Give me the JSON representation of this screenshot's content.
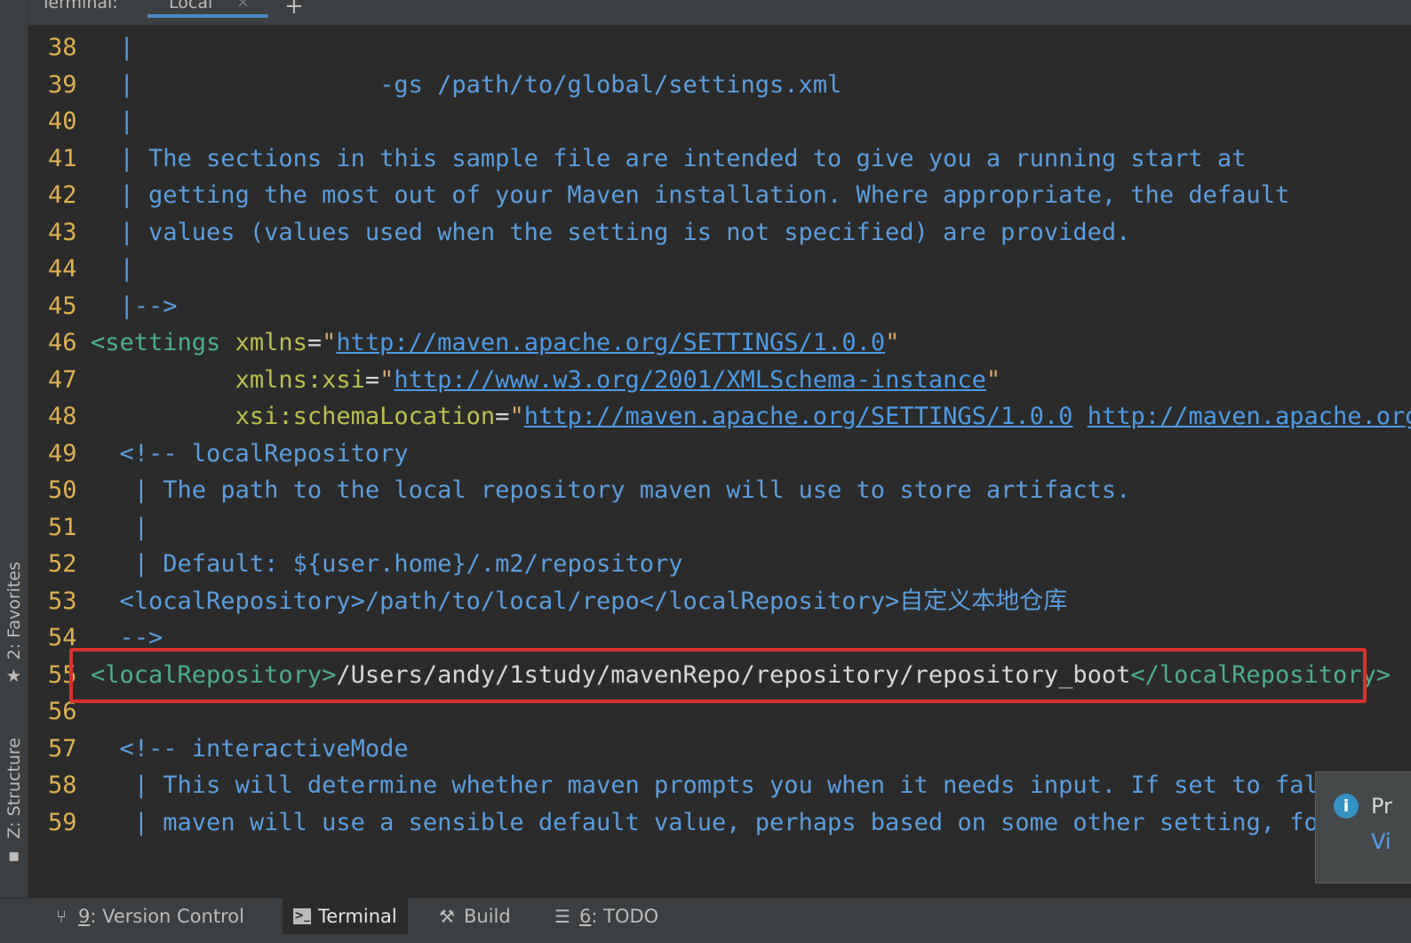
{
  "tabbar": {
    "title": "Terminal:",
    "active_tab": "Local",
    "close_glyph": "×",
    "add_glyph": "+"
  },
  "left_stripe": {
    "favorites": "2: Favorites",
    "favorites_icon": "star-icon",
    "structure": "Z: Structure",
    "structure_icon": "structure-icon"
  },
  "editor": {
    "lines": [
      {
        "n": "38",
        "parts": [
          {
            "c": "comment",
            "t": "|"
          }
        ],
        "indent": "  "
      },
      {
        "n": "39",
        "parts": [
          {
            "c": "comment",
            "t": "|                 -gs /path/to/global/settings.xml"
          }
        ],
        "indent": "  "
      },
      {
        "n": "40",
        "parts": [
          {
            "c": "comment",
            "t": "|"
          }
        ],
        "indent": "  "
      },
      {
        "n": "41",
        "parts": [
          {
            "c": "comment",
            "t": "| The sections in this sample file are intended to give you a running start at"
          }
        ],
        "indent": "  "
      },
      {
        "n": "42",
        "parts": [
          {
            "c": "comment",
            "t": "| getting the most out of your Maven installation. Where appropriate, the default"
          }
        ],
        "indent": "  "
      },
      {
        "n": "43",
        "parts": [
          {
            "c": "comment",
            "t": "| values (values used when the setting is not specified) are provided."
          }
        ],
        "indent": "  "
      },
      {
        "n": "44",
        "parts": [
          {
            "c": "comment",
            "t": "|"
          }
        ],
        "indent": "  "
      },
      {
        "n": "45",
        "parts": [
          {
            "c": "comment",
            "t": "|-->"
          }
        ],
        "indent": "  "
      },
      {
        "n": "46",
        "parts": [
          {
            "c": "tag",
            "t": "<settings "
          },
          {
            "c": "attr",
            "t": "xmlns"
          },
          {
            "c": "text",
            "t": "="
          },
          {
            "c": "str",
            "t": "\""
          },
          {
            "c": "url",
            "t": "http://maven.apache.org/SETTINGS/1.0.0"
          },
          {
            "c": "str",
            "t": "\""
          }
        ],
        "indent": ""
      },
      {
        "n": "47",
        "parts": [
          {
            "c": "attr",
            "t": "xmlns:xsi"
          },
          {
            "c": "text",
            "t": "="
          },
          {
            "c": "str",
            "t": "\""
          },
          {
            "c": "url",
            "t": "http://www.w3.org/2001/XMLSchema-instance"
          },
          {
            "c": "str",
            "t": "\""
          }
        ],
        "indent": "          "
      },
      {
        "n": "48",
        "parts": [
          {
            "c": "attr",
            "t": "xsi:schemaLocation"
          },
          {
            "c": "text",
            "t": "="
          },
          {
            "c": "str",
            "t": "\""
          },
          {
            "c": "url",
            "t": "http://maven.apache.org/SETTINGS/1.0.0"
          },
          {
            "c": "text",
            "t": " "
          },
          {
            "c": "url",
            "t": "http://maven.apache.org/"
          }
        ],
        "indent": "          "
      },
      {
        "n": "49",
        "parts": [
          {
            "c": "comment",
            "t": "<!-- localRepository"
          }
        ],
        "indent": "  "
      },
      {
        "n": "50",
        "parts": [
          {
            "c": "comment",
            "t": "| The path to the local repository maven will use to store artifacts."
          }
        ],
        "indent": "   "
      },
      {
        "n": "51",
        "parts": [
          {
            "c": "comment",
            "t": "|"
          }
        ],
        "indent": "   "
      },
      {
        "n": "52",
        "parts": [
          {
            "c": "comment",
            "t": "| Default: ${user.home}/.m2/repository"
          }
        ],
        "indent": "   "
      },
      {
        "n": "53",
        "parts": [
          {
            "c": "comment",
            "t": "<localRepository>/path/to/local/repo</localRepository>自定义本地仓库"
          }
        ],
        "indent": "  "
      },
      {
        "n": "54",
        "parts": [
          {
            "c": "comment",
            "t": "-->"
          }
        ],
        "indent": "  "
      },
      {
        "n": "55",
        "parts": [
          {
            "c": "tag",
            "t": "<localRepository>"
          },
          {
            "c": "text",
            "t": "/Users/andy/1study/mavenRepo/repository/repository_boot"
          },
          {
            "c": "tag",
            "t": "</localRepository>"
          }
        ],
        "indent": ""
      },
      {
        "n": "56",
        "parts": [],
        "indent": ""
      },
      {
        "n": "57",
        "parts": [
          {
            "c": "comment",
            "t": "<!-- interactiveMode"
          }
        ],
        "indent": "  "
      },
      {
        "n": "58",
        "parts": [
          {
            "c": "comment",
            "t": "| This will determine whether maven prompts you when it needs input. If set to false"
          }
        ],
        "indent": "   "
      },
      {
        "n": "59",
        "parts": [
          {
            "c": "comment",
            "t": "| maven will use a sensible default value, perhaps based on some other setting, for"
          }
        ],
        "indent": "   "
      }
    ]
  },
  "notification": {
    "icon": "info-icon",
    "title": "Pr",
    "link": "Vi"
  },
  "bottombar": {
    "items": [
      {
        "mnemonic": "9",
        "label": ": Version Control",
        "icon": "version-control-icon"
      },
      {
        "mnemonic": "",
        "label": "Terminal",
        "icon": "terminal-icon"
      },
      {
        "mnemonic": "",
        "label": "Build",
        "icon": "hammer-icon"
      },
      {
        "mnemonic": "6",
        "label": ": TODO",
        "icon": "list-icon"
      }
    ]
  },
  "colors": {
    "background": "#2b2b2b",
    "line_number": "#e0b14d",
    "comment": "#5a9ee0",
    "tag": "#4aaf8e",
    "highlight_box": "#d8302a"
  }
}
